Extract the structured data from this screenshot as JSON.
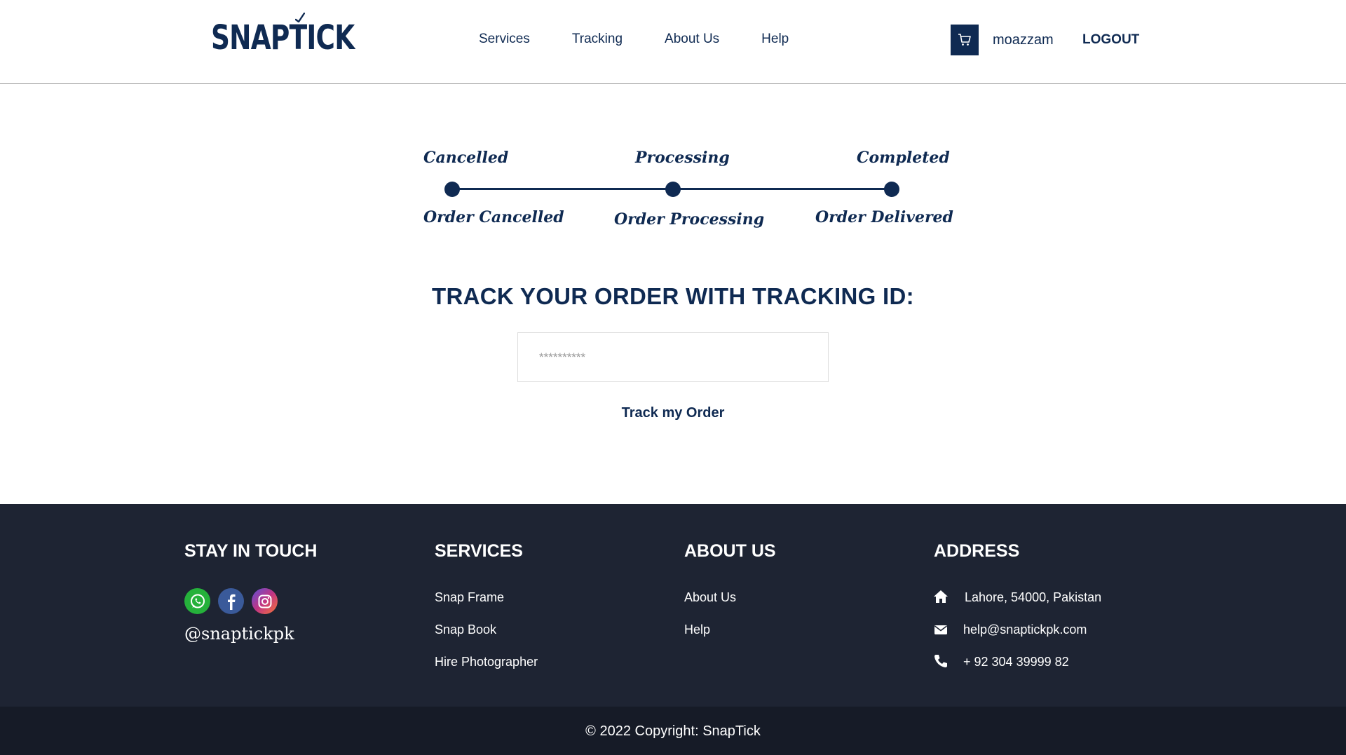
{
  "header": {
    "logo": "SNAPTICK",
    "nav": [
      "Services",
      "Tracking",
      "About Us",
      "Help"
    ],
    "username": "moazzam",
    "logout": "LOGOUT"
  },
  "progress": {
    "top_labels": [
      "Cancelled",
      "Processing",
      "Completed"
    ],
    "bottom_labels": [
      "Order Cancelled",
      "Order Processing",
      "Order Delivered"
    ]
  },
  "tracking": {
    "title": "TRACK YOUR ORDER WITH TRACKING ID:",
    "placeholder": "**********",
    "button": "Track my Order"
  },
  "footer": {
    "stay_in_touch": {
      "heading": "STAY IN TOUCH",
      "handle": "@snaptickpk",
      "icons": [
        "whatsapp-icon",
        "facebook-icon",
        "instagram-icon"
      ]
    },
    "services": {
      "heading": "SERVICES",
      "links": [
        "Snap Frame",
        "Snap Book",
        "Hire Photographer"
      ]
    },
    "about": {
      "heading": "ABOUT US",
      "links": [
        "About Us",
        "Help"
      ]
    },
    "address": {
      "heading": "ADDRESS",
      "location": "Lahore, 54000, Pakistan",
      "email": "help@snaptickpk.com",
      "phone": "+ 92 304 39999 82"
    },
    "copyright": "© 2022 Copyright: SnapTick"
  },
  "colors": {
    "primary": "#0f2a52",
    "footer_bg": "#1e2433",
    "footer_bottom": "#161b27"
  }
}
